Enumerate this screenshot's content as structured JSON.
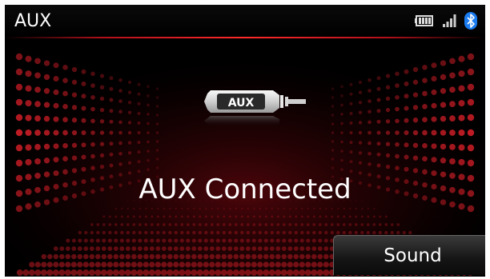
{
  "header": {
    "title": "AUX",
    "status_icons": [
      "battery-icon",
      "signal-strength-icon",
      "bluetooth-icon"
    ]
  },
  "main": {
    "source_icon_label": "AUX",
    "message": "AUX Connected"
  },
  "footer": {
    "sound_label": "Sound"
  },
  "colors": {
    "background": "#000000",
    "accent": "#e0202a",
    "bluetooth": "#1a7cf0",
    "text": "#ffffff"
  }
}
